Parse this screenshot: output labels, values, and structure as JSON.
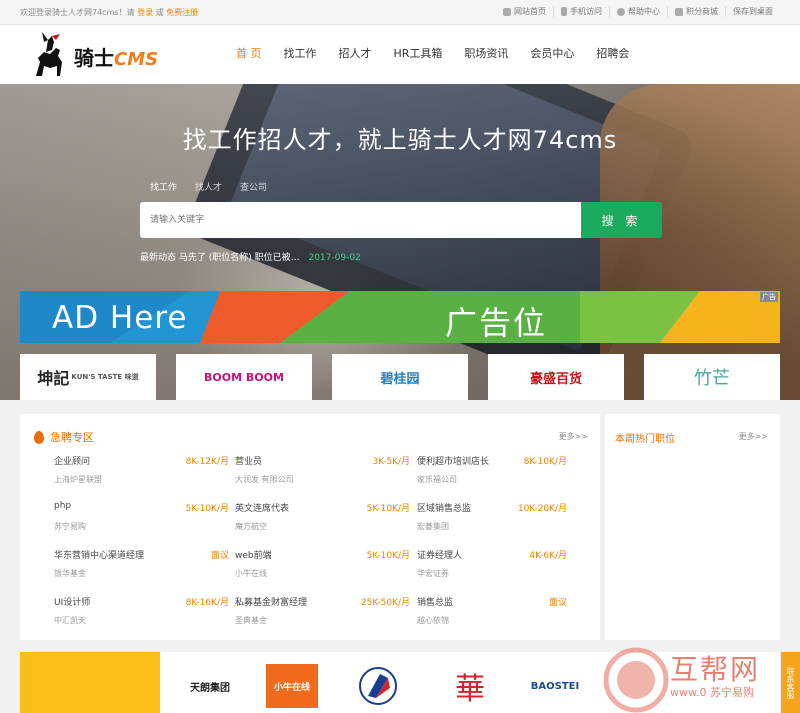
{
  "topbar": {
    "welcome_prefix": "欢迎登录骑士人才网74cms！请",
    "login": "登录",
    "or": "或",
    "register": "免费注册",
    "links": [
      {
        "icon": "home-icon",
        "label": "网站首页"
      },
      {
        "icon": "mobile-icon",
        "label": "手机访问"
      },
      {
        "icon": "help-icon",
        "label": "帮助中心"
      },
      {
        "icon": "points-mall-icon",
        "label": "积分商城"
      },
      {
        "icon": "",
        "label": "保存到桌面"
      }
    ]
  },
  "header": {
    "logo_text": "骑士",
    "logo_cms": "CMS",
    "nav": [
      "首 页",
      "找工作",
      "招人才",
      "HR工具箱",
      "职场资讯",
      "会员中心",
      "招聘会"
    ]
  },
  "hero": {
    "slogan": "找工作招人才，就上骑士人才网74cms",
    "tabs": [
      "找工作",
      "找人才",
      "查公司"
    ],
    "search_placeholder": "请输入关键字",
    "search_button": "搜 索",
    "latest_text": "最新动态  马先了 (职位名称) 职位已被…",
    "latest_date": "2017-09-02"
  },
  "ad": {
    "text_en": "AD Here",
    "text_cn": "广告位",
    "tag": "广告"
  },
  "brands": [
    {
      "name": "坤記",
      "sub": "KUN'S TASTE 味道",
      "color": "#222"
    },
    {
      "name": "BOOM BOOM",
      "sub": "",
      "color": "#c0147a"
    },
    {
      "name": "碧桂园",
      "sub": "",
      "color": "#2a7dbb"
    },
    {
      "name": "豪盛百货",
      "sub": "",
      "color": "#c4161c"
    },
    {
      "name": "竹芒",
      "sub": "",
      "color": "#4aa6a0"
    }
  ],
  "urgent": {
    "title": "急聘专区",
    "more": "更多>>",
    "jobs": [
      {
        "name": "企业顾问",
        "salary": "8K-12K/月",
        "company": "上海炉星联盟"
      },
      {
        "name": "营业员",
        "salary": "3K-5K/月",
        "company": "大润发 有限公司"
      },
      {
        "name": "便利超市培训店长",
        "salary": "8K-10K/月",
        "company": "家乐福公司"
      },
      {
        "name": "php",
        "salary": "5K-10K/月",
        "company": "苏宁易购"
      },
      {
        "name": "英文连席代表",
        "salary": "5K-10K/月",
        "company": "魔方航空"
      },
      {
        "name": "区域销售总监",
        "salary": "10K-20K/月",
        "company": "宏碁集团"
      },
      {
        "name": "华东营销中心渠道经理",
        "salary": "面议",
        "company": "银华基金"
      },
      {
        "name": "web前端",
        "salary": "5K-10K/月",
        "company": "小牛在线"
      },
      {
        "name": "证券经理人",
        "salary": "4K-6K/月",
        "company": "华宏证券"
      },
      {
        "name": "UI设计师",
        "salary": "8K-16K/月",
        "company": "中汇凯天"
      },
      {
        "name": "私募基金财富经理",
        "salary": "25K-50K/月",
        "company": "圣典基金"
      },
      {
        "name": "销售总监",
        "salary": "面议",
        "company": "越心依锦"
      }
    ]
  },
  "hot": {
    "title": "本周热门职位",
    "more": "更多>>"
  },
  "bottom_logos": [
    {
      "name": "天朗集团",
      "color": "#222"
    },
    {
      "name": "小牛在线",
      "color": "#fff",
      "bg": "#f26b1d"
    },
    {
      "name": "",
      "color": "#1a3d8f"
    },
    {
      "name": "華",
      "color": "#d1242f"
    },
    {
      "name": "BAOSTEI",
      "color": "#1a4b8f"
    }
  ],
  "watermark": {
    "text": "互帮网",
    "url": "www.0 苏宁易购"
  },
  "side_button": "联系客服"
}
